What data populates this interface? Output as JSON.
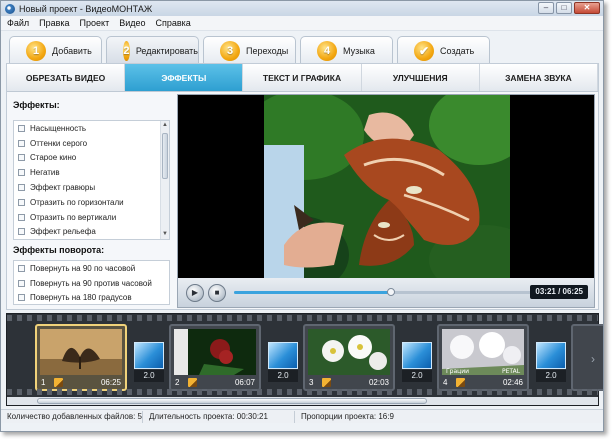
{
  "window": {
    "title": "Новый проект - ВидеоМОНТАЖ"
  },
  "menu": [
    "Файл",
    "Правка",
    "Проект",
    "Видео",
    "Справка"
  ],
  "steps": [
    {
      "num": "1",
      "label": "Добавить"
    },
    {
      "num": "2",
      "label": "Редактировать",
      "active": true
    },
    {
      "num": "3",
      "label": "Переходы"
    },
    {
      "num": "4",
      "label": "Музыка"
    },
    {
      "num": "",
      "label": "Создать"
    }
  ],
  "subtabs": [
    {
      "label": "ОБРЕЗАТЬ ВИДЕО"
    },
    {
      "label": "ЭФФЕКТЫ",
      "active": true
    },
    {
      "label": "ТЕКСТ И ГРАФИКА"
    },
    {
      "label": "УЛУЧШЕНИЯ"
    },
    {
      "label": "ЗАМЕНА ЗВУКА"
    }
  ],
  "effects": {
    "title": "Эффекты:",
    "items": [
      "Насыщенность",
      "Оттенки серого",
      "Старое кино",
      "Негатив",
      "Эффект гравюры",
      "Отразить по горизонтали",
      "Отразить по вертикали",
      "Эффект рельефа"
    ]
  },
  "rotation": {
    "title": "Эффекты поворота:",
    "items": [
      "Повернуть на 90 по часовой",
      "Повернуть на 90 против часовой",
      "Повернуть на 180 градусов"
    ]
  },
  "player": {
    "time": "03:21 / 06:25",
    "progress": 0.52
  },
  "clips": [
    {
      "num": "1",
      "dur": "06:25",
      "selected": true
    },
    {
      "num": "2",
      "dur": "06:07"
    },
    {
      "num": "3",
      "dur": "02:03"
    },
    {
      "num": "4",
      "dur": "02:46"
    }
  ],
  "transitions": [
    "2.0",
    "2.0",
    "2.0",
    "2.0"
  ],
  "clip4_overlay": [
    "Грации",
    "PETAL"
  ],
  "status": {
    "files": "Количество добавленных файлов: 5",
    "duration": "Длительность проекта:   00:30:21",
    "ratio": "Пропорции проекта:   16:9"
  }
}
